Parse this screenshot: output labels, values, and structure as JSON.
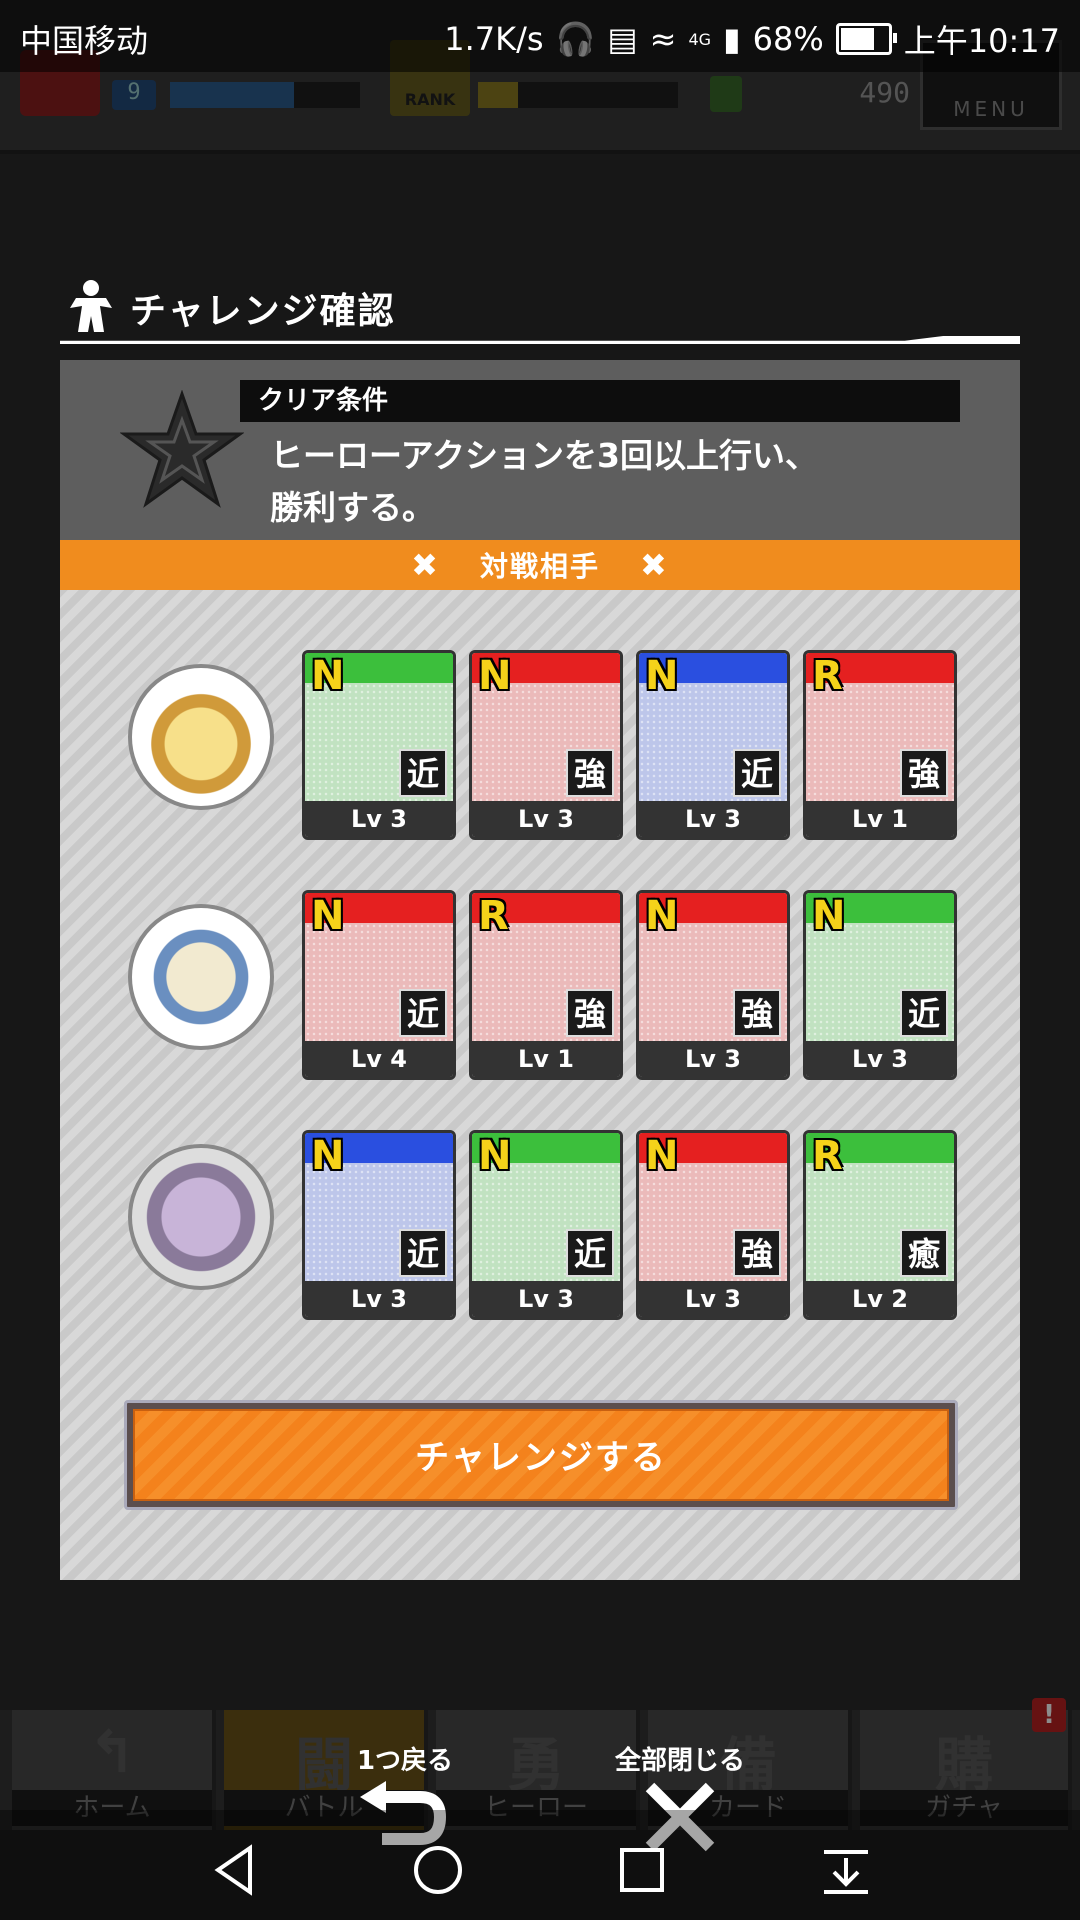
{
  "status_bar": {
    "carrier": "中国移动",
    "speed": "1.7K/s",
    "network": "4G",
    "battery": "68%",
    "time": "上午10:17"
  },
  "game_header": {
    "player_level": "9",
    "rank_label": "RANK",
    "currency_value": "490",
    "menu_label": "MENU"
  },
  "dialog": {
    "title": "チャレンジ確認",
    "condition_label": "クリア条件",
    "condition_line1": "ヒーローアクションを3回以上行い、",
    "condition_line2": "勝利する。",
    "opponent_header": "対戦相手",
    "challenge_button": "チャレンジする"
  },
  "opponents": [
    {
      "cards": [
        {
          "rarity": "N",
          "type": "近",
          "level": "Lv 3",
          "color": "#3cbf3c"
        },
        {
          "rarity": "N",
          "type": "強",
          "level": "Lv 3",
          "color": "#e52020"
        },
        {
          "rarity": "N",
          "type": "近",
          "level": "Lv 3",
          "color": "#2a4fe0"
        },
        {
          "rarity": "R",
          "type": "強",
          "level": "Lv 1",
          "color": "#e52020"
        }
      ]
    },
    {
      "cards": [
        {
          "rarity": "N",
          "type": "近",
          "level": "Lv 4",
          "color": "#e52020"
        },
        {
          "rarity": "R",
          "type": "強",
          "level": "Lv 1",
          "color": "#e52020"
        },
        {
          "rarity": "N",
          "type": "強",
          "level": "Lv 3",
          "color": "#e52020"
        },
        {
          "rarity": "N",
          "type": "近",
          "level": "Lv 3",
          "color": "#3cbf3c"
        }
      ]
    },
    {
      "cards": [
        {
          "rarity": "N",
          "type": "近",
          "level": "Lv 3",
          "color": "#2a4fe0"
        },
        {
          "rarity": "N",
          "type": "近",
          "level": "Lv 3",
          "color": "#3cbf3c"
        },
        {
          "rarity": "N",
          "type": "強",
          "level": "Lv 3",
          "color": "#e52020"
        },
        {
          "rarity": "R",
          "type": "癒",
          "level": "Lv 2",
          "color": "#3cbf3c"
        }
      ]
    }
  ],
  "bottom_nav": {
    "tabs": [
      {
        "label": "ホーム",
        "big": "↰"
      },
      {
        "label": "バトル",
        "big": "闘"
      },
      {
        "label": "ヒーロー",
        "big": "勇"
      },
      {
        "label": "カード",
        "big": "備"
      },
      {
        "label": "ガチャ",
        "big": "購"
      }
    ],
    "alert": "!",
    "back_one": "1つ戻る",
    "close_all": "全部閉じる"
  }
}
